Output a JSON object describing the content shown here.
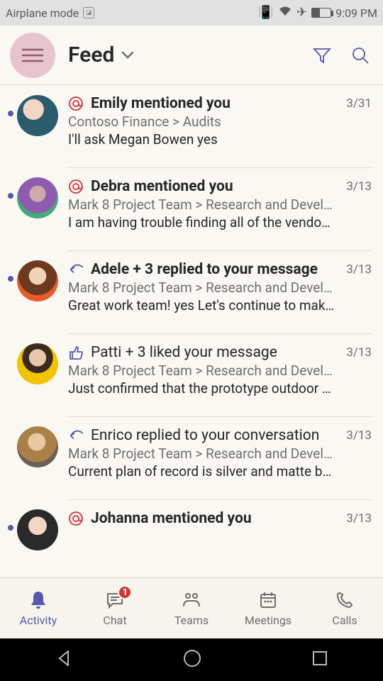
{
  "status": {
    "left_text": "Airplane mode",
    "time": "9:09 PM"
  },
  "header": {
    "title": "Feed"
  },
  "feed": [
    {
      "icon": "mention",
      "unread": true,
      "bold": true,
      "avatar": "av1",
      "title": "Emily mentioned you",
      "date": "3/31",
      "location": "Contoso Finance > Audits",
      "preview": "I'll ask Megan Bowen yes",
      "dim": false
    },
    {
      "icon": "mention",
      "unread": true,
      "bold": true,
      "avatar": "av2",
      "title": "Debra mentioned you",
      "date": "3/13",
      "location": "Mark 8 Project Team > Research and Devel…",
      "preview": "I am having trouble finding all of the vendo…",
      "dim": false
    },
    {
      "icon": "reply",
      "unread": true,
      "bold": true,
      "avatar": "av3",
      "title": "Adele + 3 replied to your message",
      "date": "3/13",
      "location": "Mark 8 Project Team > Research and Devel…",
      "preview": "Great work team! yes Let's continue to mak…",
      "dim": false
    },
    {
      "icon": "like",
      "unread": false,
      "bold": false,
      "avatar": "av4",
      "title": "Patti + 3 liked your message",
      "date": "3/13",
      "location": "Mark 8 Project Team > Research and Devel…",
      "preview": "Just confirmed that the prototype outdoor …",
      "dim": false
    },
    {
      "icon": "reply",
      "unread": false,
      "bold": false,
      "avatar": "av5",
      "title": "Enrico replied to your conversation",
      "date": "3/13",
      "location": "Mark 8 Project Team > Research and Devel…",
      "preview": "Current plan of record is silver and matte b…",
      "dim": false
    },
    {
      "icon": "mention",
      "unread": true,
      "bold": true,
      "avatar": "av6",
      "title": "Johanna mentioned you",
      "date": "3/13",
      "location": "",
      "preview": "",
      "dim": false
    }
  ],
  "nav": {
    "activity": "Activity",
    "chat": "Chat",
    "chat_badge": "1",
    "teams": "Teams",
    "meetings": "Meetings",
    "calls": "Calls"
  }
}
